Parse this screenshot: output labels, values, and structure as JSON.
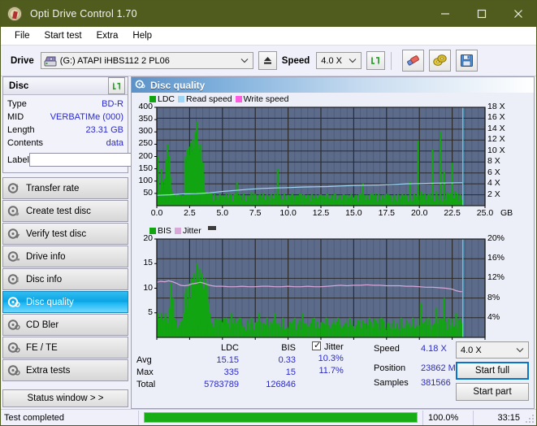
{
  "window": {
    "title": "Opti Drive Control 1.70",
    "icon": "disc-icon",
    "minimize": "minimize-icon",
    "maximize": "maximize-icon",
    "close": "close-icon",
    "titlebar_color": "#505c1e"
  },
  "menu": {
    "items": [
      "File",
      "Start test",
      "Extra",
      "Help"
    ]
  },
  "toolbar": {
    "drive_label": "Drive",
    "drive_value": "(G:)   ATAPI iHBS112  2 PL06",
    "eject_icon": "eject-icon",
    "speed_label": "Speed",
    "speed_value": "4.0 X",
    "refresh_icon": "refresh-icon",
    "erase_icon": "eraser-icon",
    "discs_icon": "two-discs-icon",
    "save_icon": "save-icon"
  },
  "disc_panel": {
    "title": "Disc",
    "refresh_icon": "refresh-icon",
    "rows": [
      {
        "key": "Type",
        "value": "BD-R"
      },
      {
        "key": "MID",
        "value": "VERBATIMe (000)"
      },
      {
        "key": "Length",
        "value": "23.31 GB"
      },
      {
        "key": "Contents",
        "value": "data"
      }
    ],
    "label_key": "Label",
    "label_value": "",
    "label_placeholder": "",
    "label_button_icon": "disc-gold-icon"
  },
  "sidebar": {
    "items": [
      {
        "label": "Transfer rate",
        "icon": "disc-transfer-icon",
        "selected": false
      },
      {
        "label": "Create test disc",
        "icon": "disc-create-icon",
        "selected": false
      },
      {
        "label": "Verify test disc",
        "icon": "disc-verify-icon",
        "selected": false
      },
      {
        "label": "Drive info",
        "icon": "disc-drive-icon",
        "selected": false
      },
      {
        "label": "Disc info",
        "icon": "disc-info-icon",
        "selected": false
      },
      {
        "label": "Disc quality",
        "icon": "disc-quality-icon",
        "selected": true
      },
      {
        "label": "CD Bler",
        "icon": "disc-bler-icon",
        "selected": false
      },
      {
        "label": "FE / TE",
        "icon": "disc-fete-icon",
        "selected": false
      },
      {
        "label": "Extra tests",
        "icon": "disc-extra-icon",
        "selected": false
      }
    ],
    "status_window_button": "Status window > >"
  },
  "panel": {
    "title": "Disc quality",
    "icon": "disc-quality-icon"
  },
  "stats": {
    "col_headers": [
      "LDC",
      "BIS"
    ],
    "rows": [
      {
        "key": "Avg",
        "ldc": "15.15",
        "bis": "0.33"
      },
      {
        "key": "Max",
        "ldc": "335",
        "bis": "15"
      },
      {
        "key": "Total",
        "ldc": "5783789",
        "bis": "126846"
      }
    ],
    "jitter_label": "Jitter",
    "jitter_checked": true,
    "jitter_avg": "10.3%",
    "jitter_max": "11.7%",
    "right": [
      {
        "key": "Speed",
        "value": "4.18 X"
      },
      {
        "key": "Position",
        "value": "23862 MB"
      },
      {
        "key": "Samples",
        "value": "381566"
      }
    ],
    "speed_select": "4.0 X",
    "start_full": "Start full",
    "start_part": "Start part"
  },
  "statusbar": {
    "message": "Test completed",
    "percent_label": "100.0%",
    "percent_value": 100,
    "elapsed": "33:15",
    "progress_color": "#16ad16"
  },
  "chart_data": [
    {
      "type": "area",
      "name": "top-chart",
      "title": "",
      "xlabel": "GB",
      "ylabel": "",
      "y2label": "X",
      "xlim": [
        0,
        25.0
      ],
      "ylim": [
        0,
        400
      ],
      "y2lim": [
        0,
        18
      ],
      "xticks": [
        0.0,
        2.5,
        5.0,
        7.5,
        10.0,
        12.5,
        15.0,
        17.5,
        20.0,
        22.5,
        25.0
      ],
      "xticklabels": [
        "0.0",
        "2.5",
        "5.0",
        "7.5",
        "10.0",
        "12.5",
        "15.0",
        "17.5",
        "20.0",
        "22.5",
        "25.0"
      ],
      "yticks": [
        50,
        100,
        150,
        200,
        250,
        300,
        350,
        400
      ],
      "y2ticks": [
        2,
        4,
        6,
        8,
        10,
        12,
        14,
        16,
        18
      ],
      "y2ticklabels": [
        "2 X",
        "4 X",
        "6 X",
        "8 X",
        "10 X",
        "12 X",
        "14 X",
        "16 X",
        "18 X"
      ],
      "grid": true,
      "plot_bg": "#5c6b8a",
      "legend_position": "top-left",
      "legend": [
        {
          "label": "LDC",
          "color": "#12a512"
        },
        {
          "label": "Read speed",
          "color": "#9fd6f5"
        },
        {
          "label": "Write speed",
          "color": "#ff5ce0"
        }
      ],
      "data_end_gb": 23.31,
      "series": [
        {
          "name": "LDC",
          "color": "#12a512",
          "kind": "impulse",
          "axis": "left",
          "x": [
            0.05,
            0.12,
            0.2,
            0.28,
            0.35,
            0.42,
            0.5,
            0.58,
            0.65,
            0.72,
            0.8,
            0.88,
            0.95,
            1.02,
            1.1,
            1.18,
            1.25,
            1.32,
            1.4,
            1.48,
            1.55,
            1.62,
            1.7,
            1.78,
            1.85,
            1.92,
            2.0,
            2.08,
            2.15,
            2.22,
            2.3,
            2.38,
            2.45,
            2.52,
            2.6,
            2.68,
            2.75,
            2.82,
            2.9,
            2.98,
            3.05,
            3.12,
            3.2,
            3.28,
            3.35,
            3.42,
            3.5,
            3.58,
            3.65,
            3.72,
            3.8,
            3.88,
            3.95,
            4.02,
            4.1,
            4.2,
            4.4,
            4.6,
            4.8,
            5.0,
            5.3,
            5.6,
            5.9,
            6.1,
            6.3,
            6.6,
            6.9,
            7.2,
            7.5,
            7.8,
            8.1,
            8.4,
            8.7,
            9.0,
            9.2,
            9.4,
            9.7,
            10.0,
            10.3,
            10.6,
            10.9,
            11.2,
            11.5,
            11.8,
            12.1,
            12.4,
            12.7,
            13.0,
            13.3,
            13.6,
            13.9,
            14.2,
            14.5,
            14.8,
            15.1,
            15.4,
            15.7,
            16.0,
            16.3,
            16.6,
            16.9,
            17.2,
            17.5,
            17.8,
            18.1,
            18.4,
            18.7,
            19.0,
            19.3,
            19.6,
            19.9,
            20.1,
            20.4,
            20.7,
            21.0,
            21.3,
            21.6,
            21.9,
            22.1,
            22.3,
            22.5,
            22.7,
            22.9,
            23.1,
            23.25
          ],
          "y": [
            200,
            95,
            60,
            70,
            150,
            100,
            65,
            110,
            80,
            190,
            250,
            150,
            205,
            120,
            70,
            55,
            42,
            45,
            40,
            38,
            42,
            45,
            40,
            38,
            42,
            40,
            38,
            42,
            200,
            175,
            230,
            195,
            240,
            205,
            255,
            220,
            270,
            235,
            300,
            265,
            340,
            250,
            230,
            210,
            250,
            180,
            175,
            130,
            60,
            50,
            45,
            50,
            42,
            48,
            55,
            45,
            50,
            40,
            48,
            42,
            50,
            45,
            48,
            95,
            45,
            50,
            42,
            55,
            48,
            44,
            50,
            46,
            48,
            52,
            150,
            45,
            50,
            44,
            48,
            42,
            50,
            46,
            44,
            48,
            40,
            46,
            42,
            48,
            44,
            50,
            42,
            46,
            44,
            48,
            42,
            46,
            90,
            44,
            48,
            42,
            46,
            44,
            48,
            42,
            46,
            44,
            48,
            42,
            100,
            46,
            265,
            60,
            52,
            48,
            230,
            60,
            300,
            140,
            55,
            50,
            175,
            60,
            50
          ]
        },
        {
          "name": "Read speed",
          "color": "#9fd6f5",
          "kind": "line",
          "axis": "right",
          "x": [
            0.0,
            1.0,
            2.0,
            3.0,
            4.0,
            5.0,
            6.0,
            7.0,
            8.0,
            9.0,
            10.0,
            11.0,
            12.0,
            13.0,
            14.0,
            15.0,
            16.0,
            17.0,
            18.0,
            19.0,
            20.0,
            21.0,
            22.0,
            23.0,
            23.31
          ],
          "y": [
            1.9,
            2.0,
            2.15,
            2.2,
            2.35,
            2.6,
            2.8,
            3.0,
            3.15,
            3.25,
            3.3,
            3.4,
            3.45,
            3.5,
            3.6,
            3.7,
            3.75,
            3.8,
            3.9,
            4.0,
            4.05,
            4.1,
            4.15,
            4.18,
            4.18
          ]
        }
      ]
    },
    {
      "type": "area",
      "name": "bottom-chart",
      "title": "",
      "xlabel": "GB",
      "ylabel": "",
      "y2label": "%",
      "xlim": [
        0,
        25.0
      ],
      "ylim": [
        0,
        20
      ],
      "y2lim": [
        0,
        20
      ],
      "xticks": [
        0.0,
        2.5,
        5.0,
        7.5,
        10.0,
        12.5,
        15.0,
        17.5,
        20.0,
        22.5,
        25.0
      ],
      "xticklabels": [
        "0.0",
        "2.5",
        "5.0",
        "7.5",
        "10.0",
        "12.5",
        "15.0",
        "17.5",
        "20.0",
        "22.5",
        "25.0"
      ],
      "yticks": [
        5,
        10,
        15,
        20
      ],
      "y2ticks": [
        4,
        8,
        12,
        16,
        20
      ],
      "y2ticklabels": [
        "4%",
        "8%",
        "12%",
        "16%",
        "20%"
      ],
      "grid": true,
      "plot_bg": "#5c6b8a",
      "legend_position": "top-left",
      "legend": [
        {
          "label": "BIS",
          "color": "#12a512"
        },
        {
          "label": "Jitter",
          "color": "#d9a8d9"
        },
        {
          "label": "",
          "color": "#3c3c3c"
        }
      ],
      "data_end_gb": 23.31,
      "series": [
        {
          "name": "BIS",
          "color": "#12a512",
          "kind": "impulse",
          "axis": "left",
          "x": [
            0.05,
            0.15,
            0.25,
            0.35,
            0.45,
            0.55,
            0.65,
            0.75,
            0.85,
            0.95,
            1.05,
            1.15,
            1.25,
            1.35,
            1.45,
            1.55,
            1.65,
            1.75,
            1.85,
            1.95,
            2.05,
            2.15,
            2.25,
            2.35,
            2.45,
            2.55,
            2.65,
            2.75,
            2.85,
            2.95,
            3.05,
            3.15,
            3.25,
            3.35,
            3.45,
            3.55,
            3.65,
            3.75,
            3.85,
            3.95,
            4.05,
            4.2,
            4.5,
            4.8,
            5.1,
            5.4,
            5.7,
            6.0,
            6.3,
            6.6,
            6.9,
            7.2,
            7.5,
            7.8,
            8.1,
            8.4,
            8.7,
            9.0,
            9.3,
            9.6,
            9.9,
            10.2,
            10.5,
            10.8,
            11.1,
            11.4,
            11.7,
            12.0,
            12.3,
            12.6,
            12.9,
            13.2,
            13.5,
            13.8,
            14.1,
            14.4,
            14.7,
            15.0,
            15.3,
            15.6,
            15.9,
            16.2,
            16.5,
            16.8,
            17.1,
            17.4,
            17.7,
            18.0,
            18.3,
            18.6,
            18.9,
            19.2,
            19.5,
            19.8,
            20.1,
            20.4,
            20.7,
            21.0,
            21.3,
            21.6,
            21.9,
            22.2,
            22.5,
            22.8,
            23.1,
            23.25
          ],
          "y": [
            5,
            3,
            4,
            5,
            3,
            4,
            5,
            4,
            3,
            6,
            11,
            8,
            8,
            4,
            3,
            2,
            2,
            2,
            2,
            2,
            5,
            9,
            10,
            6,
            11,
            8,
            12,
            10,
            13,
            11,
            15,
            12,
            14,
            11,
            13,
            10,
            12,
            9,
            11,
            7,
            5,
            3,
            2,
            3,
            4,
            3,
            5,
            3,
            4,
            2,
            3,
            4,
            3,
            5,
            3,
            4,
            3,
            5,
            3,
            4,
            2,
            3,
            4,
            3,
            5,
            2,
            3,
            4,
            2,
            3,
            4,
            2,
            3,
            4,
            2,
            3,
            4,
            2,
            3,
            2,
            3,
            4,
            2,
            3,
            4,
            2,
            3,
            2,
            3,
            4,
            2,
            3,
            4,
            2,
            7,
            3,
            4,
            2,
            6,
            3,
            8,
            4,
            3,
            5,
            4,
            3
          ]
        },
        {
          "name": "Jitter",
          "color": "#d9a8d9",
          "kind": "line",
          "axis": "left",
          "x": [
            0.0,
            0.3,
            0.6,
            0.9,
            1.2,
            1.5,
            1.8,
            2.1,
            2.4,
            2.7,
            3.0,
            3.3,
            3.6,
            3.9,
            4.2,
            4.5,
            5.0,
            5.5,
            6.0,
            6.5,
            7.0,
            7.5,
            8.0,
            8.5,
            9.0,
            9.5,
            10.0,
            10.5,
            11.0,
            11.5,
            12.0,
            12.5,
            13.0,
            13.5,
            14.0,
            14.5,
            15.0,
            15.5,
            16.0,
            16.5,
            17.0,
            17.5,
            18.0,
            18.5,
            19.0,
            19.5,
            20.0,
            20.5,
            21.0,
            21.5,
            22.0,
            22.5,
            22.8,
            23.1,
            23.25
          ],
          "y": [
            11.2,
            11.4,
            11.3,
            11.5,
            11.3,
            11.0,
            10.6,
            10.5,
            10.6,
            10.9,
            11.0,
            11.2,
            11.0,
            10.7,
            10.5,
            10.4,
            10.4,
            10.3,
            10.3,
            10.4,
            10.3,
            10.3,
            10.4,
            10.4,
            10.3,
            10.3,
            10.4,
            10.3,
            10.3,
            10.4,
            10.3,
            10.3,
            10.4,
            10.5,
            10.6,
            10.5,
            10.6,
            10.6,
            10.7,
            10.6,
            10.6,
            10.5,
            10.5,
            10.5,
            10.4,
            10.4,
            10.3,
            10.2,
            10.2,
            10.1,
            10.0,
            9.8,
            9.5,
            9.3,
            9.3
          ]
        }
      ]
    }
  ]
}
